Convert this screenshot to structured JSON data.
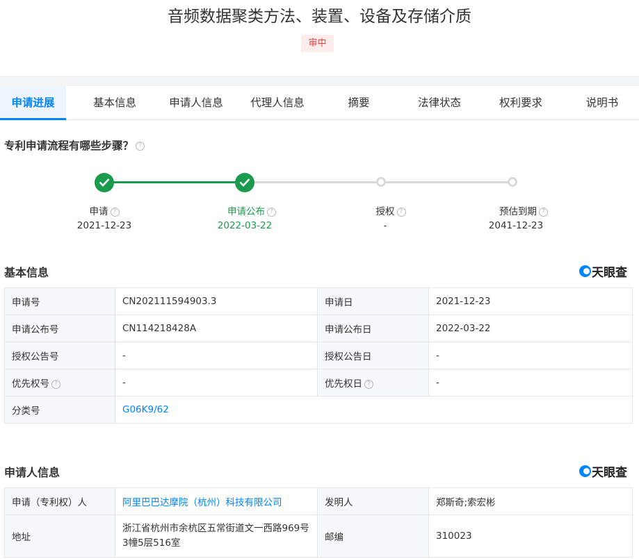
{
  "header": {
    "title": "音频数据聚类方法、装置、设备及存储介质",
    "status": "审中"
  },
  "tabs": [
    {
      "label": "申请进展",
      "active": true
    },
    {
      "label": "基本信息"
    },
    {
      "label": "申请人信息"
    },
    {
      "label": "代理人信息"
    },
    {
      "label": "摘要"
    },
    {
      "label": "法律状态"
    },
    {
      "label": "权利要求"
    },
    {
      "label": "说明书"
    }
  ],
  "process": {
    "question": "专利申请流程有哪些步骤？",
    "steps": [
      {
        "label": "申请",
        "date": "2021-12-23",
        "done": true
      },
      {
        "label": "申请公布",
        "date": "2022-03-22",
        "done": true,
        "current": true
      },
      {
        "label": "授权",
        "date": "-",
        "done": false
      },
      {
        "label": "预估到期",
        "date": "2041-12-23",
        "done": false
      }
    ]
  },
  "basic_info": {
    "title": "基本信息",
    "logo": "天眼查",
    "rows": [
      {
        "k1": "申请号",
        "v1": "CN202111594903.3",
        "k2": "申请日",
        "v2": "2021-12-23"
      },
      {
        "k1": "申请公布号",
        "v1": "CN114218428A",
        "k2": "申请公布日",
        "v2": "2022-03-22"
      },
      {
        "k1": "授权公告号",
        "v1": "-",
        "k2": "授权公告日",
        "v2": "-"
      },
      {
        "k1": "优先权号",
        "v1": "-",
        "k2": "优先权日",
        "v2": "-"
      }
    ],
    "class_label": "分类号",
    "class_value": "G06K9/62"
  },
  "applicant_info": {
    "title": "申请人信息",
    "logo": "天眼查",
    "applicant_label": "申请（专利权）人",
    "applicant_value": "阿里巴巴达摩院（杭州）科技有限公司",
    "inventor_label": "发明人",
    "inventor_value": "郑斯奇;索宏彬",
    "address_label": "地址",
    "address_value": "浙江省杭州市余杭区五常街道文一西路969号3幢5层516室",
    "zip_label": "邮编",
    "zip_value": "310023"
  },
  "colors": {
    "accent": "#0084ff",
    "done": "#1a9a4c",
    "status_bg": "#fdecec",
    "status_text": "#e54545"
  }
}
